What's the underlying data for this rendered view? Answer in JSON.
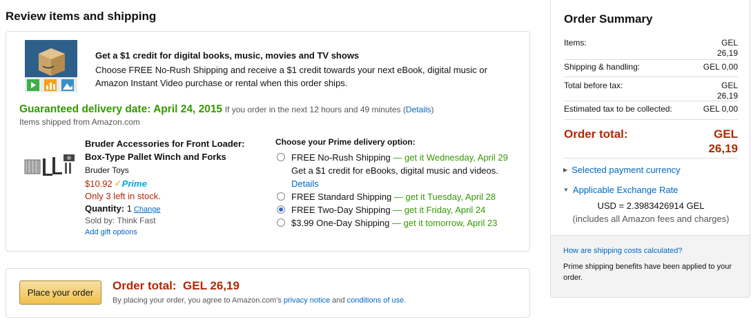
{
  "section_title": "Review items and shipping",
  "promo": {
    "headline": "Get a $1 credit for digital books, music, movies and TV shows",
    "body": "Choose FREE No-Rush Shipping and receive a $1 credit towards your next eBook, digital music or Amazon Instant Video purchase or rental when this order ships."
  },
  "delivery": {
    "guarantee": "Guaranteed delivery date: April 24, 2015",
    "condition": "If you order in the next 12 hours and 49 minutes",
    "details_link": "Details",
    "shipped_from": "Items shipped from Amazon.com"
  },
  "product": {
    "title": "Bruder Accessories for Front Loader: Box-Type Pallet Winch and Forks",
    "brand": "Bruder Toys",
    "price": "$10.92",
    "prime_label": "Prime",
    "stock": "Only 3 left in stock.",
    "quantity_label": "Quantity:",
    "quantity_value": "1",
    "change_link": "Change",
    "sold_by": "Sold by:  Think Fast",
    "gift_link": "Add gift options"
  },
  "shipping": {
    "heading": "Choose your Prime delivery option:",
    "options": [
      {
        "label": "FREE No-Rush Shipping",
        "date": "— get it Wednesday, April 29",
        "extra": "Get a $1 credit for eBooks, digital music and videos.",
        "extra_link": "Details",
        "selected": false
      },
      {
        "label": "FREE Standard Shipping",
        "date": "— get it Tuesday, April 28",
        "selected": false
      },
      {
        "label": "FREE Two-Day Shipping",
        "date": "— get it Friday, April 24",
        "selected": true
      },
      {
        "label": "$3.99 One-Day Shipping",
        "date": "— get it tomorrow, April 23",
        "selected": false
      }
    ]
  },
  "place_order": {
    "button_label": "Place your order",
    "total_label": "Order total:",
    "total_value": "GEL 26,19",
    "agree_prefix": "By placing your order, you agree to Amazon.com's",
    "privacy_link": "privacy notice",
    "and": "and",
    "conditions_link": "conditions of use."
  },
  "summary": {
    "title": "Order Summary",
    "rows": [
      {
        "label": "Items:",
        "amount_line1": "GEL",
        "amount_line2": "26,19"
      },
      {
        "label": "Shipping & handling:",
        "amount_line1": "GEL 0,00",
        "amount_line2": ""
      },
      {
        "label": "Total before tax:",
        "amount_line1": "GEL",
        "amount_line2": "26,19"
      },
      {
        "label": "Estimated tax to be collected:",
        "amount_line1": "GEL 0,00",
        "amount_line2": ""
      }
    ],
    "total_label": "Order total:",
    "total_line1": "GEL",
    "total_line2": "26,19",
    "selected_currency_link": "Selected payment currency",
    "exchange_rate_link": "Applicable Exchange Rate",
    "rate": "USD = 2.3983426914 GEL",
    "rate_note": "(includes all Amazon fees and charges)",
    "footer_question": "How are shipping costs calculated?",
    "footer_note": "Prime shipping benefits have been applied to your order."
  },
  "colors": {
    "price_red": "#b12704",
    "guarantee_green": "#339900",
    "link_blue": "#0066c0",
    "prime_blue": "#00a8e1",
    "button_gold": "#f0c14b"
  }
}
